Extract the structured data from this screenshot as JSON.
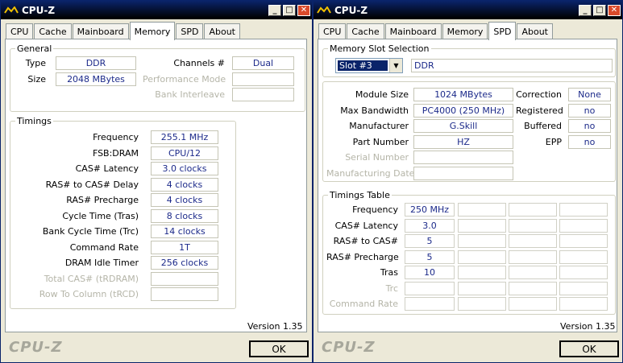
{
  "app_title": "CPU-Z",
  "tabs": [
    "CPU",
    "Cache",
    "Mainboard",
    "Memory",
    "SPD",
    "About"
  ],
  "memory": {
    "general": {
      "legend": "General",
      "type_label": "Type",
      "type_value": "DDR",
      "size_label": "Size",
      "size_value": "2048 MBytes",
      "channels_label": "Channels #",
      "channels_value": "Dual",
      "perf_mode_label": "Performance Mode",
      "bank_interleave_label": "Bank Interleave"
    },
    "timings": {
      "legend": "Timings",
      "rows": [
        {
          "label": "Frequency",
          "value": "255.1 MHz",
          "disabled": false
        },
        {
          "label": "FSB:DRAM",
          "value": "CPU/12",
          "disabled": false
        },
        {
          "label": "CAS# Latency",
          "value": "3.0 clocks",
          "disabled": false
        },
        {
          "label": "RAS# to CAS# Delay",
          "value": "4 clocks",
          "disabled": false
        },
        {
          "label": "RAS# Precharge",
          "value": "4 clocks",
          "disabled": false
        },
        {
          "label": "Cycle Time (Tras)",
          "value": "8 clocks",
          "disabled": false
        },
        {
          "label": "Bank Cycle Time (Trc)",
          "value": "14 clocks",
          "disabled": false
        },
        {
          "label": "Command Rate",
          "value": "1T",
          "disabled": false
        },
        {
          "label": "DRAM Idle Timer",
          "value": "256 clocks",
          "disabled": false
        },
        {
          "label": "Total CAS# (tRDRAM)",
          "value": "",
          "disabled": true
        },
        {
          "label": "Row To Column (tRCD)",
          "value": "",
          "disabled": true
        }
      ]
    },
    "version": "Version 1.35"
  },
  "spd": {
    "slot": {
      "legend": "Memory Slot Selection",
      "selected": "Slot #3",
      "type": "DDR"
    },
    "left_rows": [
      {
        "label": "Module Size",
        "value": "1024 MBytes",
        "disabled": false
      },
      {
        "label": "Max Bandwidth",
        "value": "PC4000 (250 MHz)",
        "disabled": false
      },
      {
        "label": "Manufacturer",
        "value": "G.Skill",
        "disabled": false
      },
      {
        "label": "Part Number",
        "value": "HZ",
        "disabled": false
      },
      {
        "label": "Serial Number",
        "value": "",
        "disabled": true
      },
      {
        "label": "Manufacturing Date",
        "value": "",
        "disabled": true
      }
    ],
    "right_rows": [
      {
        "label": "Correction",
        "value": "None"
      },
      {
        "label": "Registered",
        "value": "no"
      },
      {
        "label": "Buffered",
        "value": "no"
      },
      {
        "label": "EPP",
        "value": "no"
      }
    ],
    "timings_table": {
      "legend": "Timings Table",
      "rows": [
        {
          "label": "Frequency",
          "value": "250 MHz",
          "disabled": false
        },
        {
          "label": "CAS# Latency",
          "value": "3.0",
          "disabled": false
        },
        {
          "label": "RAS# to CAS#",
          "value": "5",
          "disabled": false
        },
        {
          "label": "RAS# Precharge",
          "value": "5",
          "disabled": false
        },
        {
          "label": "Tras",
          "value": "10",
          "disabled": false
        },
        {
          "label": "Trc",
          "value": "",
          "disabled": true
        },
        {
          "label": "Command Rate",
          "value": "",
          "disabled": true
        }
      ]
    },
    "version": "Version 1.35"
  },
  "brand": "CPU-Z",
  "ok_label": "OK",
  "title_buttons": {
    "minimize": "_",
    "maximize": "□",
    "close": "✕"
  }
}
